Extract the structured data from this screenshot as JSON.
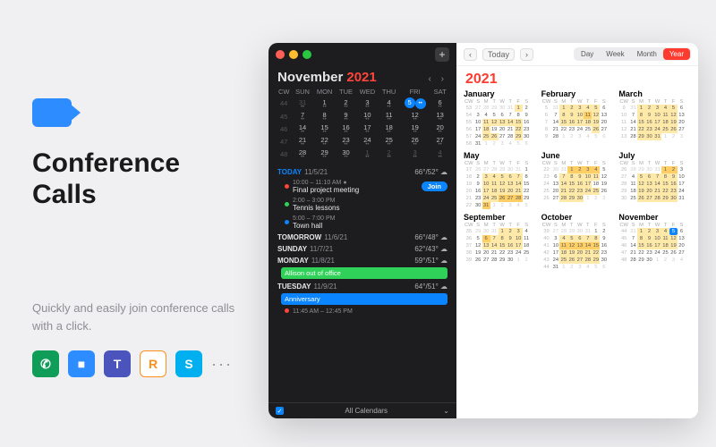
{
  "promo": {
    "title": "Conference Calls",
    "subtitle": "Quickly and easily join conference calls with a click.",
    "services": [
      {
        "name": "hangouts",
        "bg": "#0f9d58",
        "glyph": "✆"
      },
      {
        "name": "zoom",
        "bg": "#2d8cff",
        "glyph": "■"
      },
      {
        "name": "teams",
        "bg": "#4b53bc",
        "glyph": "T"
      },
      {
        "name": "ringcentral",
        "bg": "#fff",
        "glyph": "R",
        "fg": "#ff8f1c",
        "border": "#ff8f1c"
      },
      {
        "name": "skype",
        "bg": "#00aff0",
        "glyph": "S"
      }
    ]
  },
  "sidebar": {
    "month": "November",
    "year": "2021",
    "dow": [
      "CW",
      "SUN",
      "MON",
      "TUE",
      "WED",
      "THU",
      "FRI",
      "SAT"
    ],
    "rows": [
      {
        "cw": "44",
        "d": [
          {
            "n": "31",
            "dim": true
          },
          {
            "n": "1"
          },
          {
            "n": "2"
          },
          {
            "n": "3"
          },
          {
            "n": "4"
          },
          {
            "n": "5",
            "today": true
          },
          {
            "n": "6"
          }
        ]
      },
      {
        "cw": "45",
        "d": [
          {
            "n": "7"
          },
          {
            "n": "8"
          },
          {
            "n": "9"
          },
          {
            "n": "10"
          },
          {
            "n": "11"
          },
          {
            "n": "12"
          },
          {
            "n": "13"
          }
        ]
      },
      {
        "cw": "46",
        "d": [
          {
            "n": "14"
          },
          {
            "n": "15"
          },
          {
            "n": "16"
          },
          {
            "n": "17"
          },
          {
            "n": "18"
          },
          {
            "n": "19"
          },
          {
            "n": "20"
          }
        ]
      },
      {
        "cw": "47",
        "d": [
          {
            "n": "21"
          },
          {
            "n": "22"
          },
          {
            "n": "23"
          },
          {
            "n": "24"
          },
          {
            "n": "25"
          },
          {
            "n": "26"
          },
          {
            "n": "27"
          }
        ]
      },
      {
        "cw": "48",
        "d": [
          {
            "n": "28"
          },
          {
            "n": "29"
          },
          {
            "n": "30"
          },
          {
            "n": "1",
            "dim": true
          },
          {
            "n": "2",
            "dim": true
          },
          {
            "n": "3",
            "dim": true
          },
          {
            "n": "4",
            "dim": true
          }
        ]
      }
    ],
    "agenda": [
      {
        "label": "TODAY",
        "date": "11/5/21",
        "wx": "66°/52°",
        "today": true,
        "items": [
          {
            "type": "evt",
            "time": "10:00 – 11:10 AM",
            "name": "Final project meeting",
            "color": "#ff453a",
            "camera": true,
            "join": true
          },
          {
            "type": "evt",
            "time": "2:00 – 3:00 PM",
            "name": "Tennis lessons",
            "color": "#30d158"
          },
          {
            "type": "evt",
            "time": "5:00 – 7:00 PM",
            "name": "Town hall",
            "color": "#0a84ff"
          }
        ]
      },
      {
        "label": "TOMORROW",
        "date": "11/6/21",
        "wx": "66°/48°",
        "items": []
      },
      {
        "label": "SUNDAY",
        "date": "11/7/21",
        "wx": "62°/43°",
        "items": []
      },
      {
        "label": "MONDAY",
        "date": "11/8/21",
        "wx": "59°/51°",
        "items": [
          {
            "type": "pill",
            "name": "Allison out of office",
            "bg": "#30d158"
          }
        ]
      },
      {
        "label": "TUESDAY",
        "date": "11/9/21",
        "wx": "64°/51°",
        "items": [
          {
            "type": "pill",
            "name": "Anniversary",
            "bg": "#0a84ff"
          },
          {
            "type": "evt",
            "time": "11:45 AM – 12:45 PM",
            "name": "",
            "color": "#ff453a"
          }
        ]
      }
    ],
    "footer_select": "All Calendars",
    "join_label": "Join"
  },
  "toolbar": {
    "today": "Today",
    "views": [
      "Day",
      "Week",
      "Month",
      "Year"
    ],
    "active": "Year"
  },
  "year": {
    "label": "2021",
    "dow": [
      "CW",
      "S",
      "M",
      "T",
      "W",
      "T",
      "F",
      "S"
    ],
    "months": [
      {
        "name": "January",
        "startCW": 53,
        "first": 5,
        "days": 31,
        "hl": [
          1,
          11,
          12,
          13,
          14,
          15,
          18,
          22,
          25,
          26,
          29
        ],
        "hl2": []
      },
      {
        "name": "February",
        "startCW": 5,
        "first": 1,
        "days": 28,
        "hl": [
          1,
          2,
          3,
          4,
          5,
          8,
          9,
          10,
          12,
          15,
          16,
          17,
          18,
          19,
          26
        ],
        "hl2": [
          11
        ]
      },
      {
        "name": "March",
        "startCW": 9,
        "first": 1,
        "days": 31,
        "hl": [
          1,
          2,
          3,
          4,
          5,
          8,
          9,
          10,
          11,
          12,
          15,
          16,
          17,
          18,
          19,
          22,
          23,
          24,
          25,
          26,
          29,
          30,
          31
        ],
        "hl2": []
      },
      {
        "name": "May",
        "startCW": 17,
        "first": 6,
        "days": 31,
        "hl": [
          3,
          4,
          5,
          6,
          7,
          10,
          11,
          12,
          13,
          14,
          17,
          18,
          19,
          20,
          21,
          24,
          25
        ],
        "hl2": [
          26,
          27,
          28,
          31
        ]
      },
      {
        "name": "June",
        "startCW": 22,
        "first": 2,
        "days": 30,
        "hl": [
          7,
          8,
          9,
          10,
          11,
          14,
          15,
          16,
          17,
          21,
          22,
          23,
          24,
          25,
          28,
          29,
          30
        ],
        "hl2": [
          1,
          2,
          3,
          4
        ]
      },
      {
        "name": "July",
        "startCW": 26,
        "first": 4,
        "days": 31,
        "hl": [
          5,
          6,
          7,
          8,
          9,
          12,
          13,
          14,
          15,
          16,
          19,
          20,
          21,
          22,
          23,
          26,
          27,
          28,
          29,
          30
        ],
        "hl2": [
          1,
          2
        ]
      },
      {
        "name": "September",
        "startCW": 35,
        "first": 3,
        "days": 30,
        "hl": [
          1,
          2,
          3,
          7,
          8,
          9,
          10,
          13,
          14,
          15,
          16,
          17
        ],
        "hl2": [
          6
        ]
      },
      {
        "name": "October",
        "startCW": 39,
        "first": 5,
        "days": 31,
        "hl": [
          4,
          5,
          6,
          7,
          8,
          18,
          19,
          20,
          21,
          22,
          25,
          26,
          27,
          28,
          29
        ],
        "hl2": [
          11,
          12,
          13,
          14,
          15
        ]
      },
      {
        "name": "November",
        "startCW": 44,
        "first": 1,
        "days": 30,
        "hl": [
          1,
          2,
          3,
          4,
          8,
          9,
          10,
          11,
          12,
          15,
          16,
          17,
          18,
          19
        ],
        "hl2": [],
        "today": 5
      }
    ]
  }
}
